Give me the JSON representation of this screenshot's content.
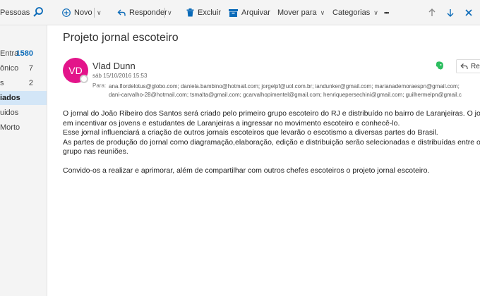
{
  "toolbar": {
    "search_label": "Pessoas",
    "new_label": "Novo",
    "reply_label": "Responder",
    "delete_label": "Excluir",
    "archive_label": "Arquivar",
    "move_label": "Mover para",
    "categories_label": "Categorias",
    "more_label": "•••"
  },
  "nav": {
    "items": [
      {
        "label": "Entra",
        "count": "1580"
      },
      {
        "label": "ônico",
        "count": "7"
      },
      {
        "label": "s",
        "count": "2"
      },
      {
        "label": "iados",
        "count": ""
      },
      {
        "label": "uidos",
        "count": ""
      },
      {
        "label": "Morto",
        "count": ""
      }
    ]
  },
  "message": {
    "subject": "Projeto jornal escoteiro",
    "avatar_initials": "VD",
    "sender": "Vlad Dunn",
    "date": "sáb 15/10/2016 15:53",
    "to_label": "Para:",
    "recipients_line1": "ana.flordelotus@globo.com;  daniela.bambino@hotmail.com;  jorgelpf@uol.com.br;  iandunker@gmail.com;  marianademoraespn@gmail.com;",
    "recipients_line2": "dani-carvalho-28@hotmail.com;  tsmalta@gmail.com;  gcarvalhopimentel@gmail.com;  henriquepersechini@gmail.com;  guilhermelpn@gmail.c",
    "reply_button": "Res",
    "body": [
      "O jornal do João Ribeiro dos Santos será criado pelo primeiro grupo escoteiro do RJ e distribuído no bairro de Laranjeiras. O jornal",
      "em incentivar os jovens e estudantes de Laranjeiras a  ingressar no movimento escoteiro e conhecê-lo.",
      "Esse jornal influenciará a criação de outros jornais escoteiros que levarão o escotismo a diversas partes do Brasil.",
      "As partes de produção do jornal como diagramação,elaboração, edição e distribuição serão selecionadas e distribuídas entre os mo",
      "grupo nas reuniões.",
      "",
      "Convido-os a realizar e aprimorar, além de compartilhar com outros chefes escoteiros o projeto jornal escoteiro."
    ]
  },
  "colors": {
    "accent": "#0a6ab8",
    "avatar": "#e3148a",
    "selected_nav": "#d3e6f7"
  }
}
